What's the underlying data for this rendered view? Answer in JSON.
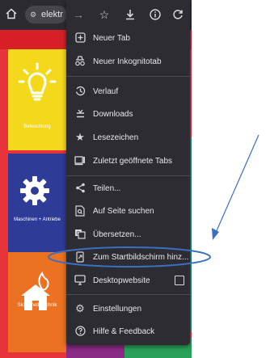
{
  "browser": {
    "url_text": "elektr",
    "toolbar_icons": [
      "home-icon",
      "site-settings-icon",
      "forward-icon",
      "bookmark-star-icon",
      "download-icon",
      "info-icon",
      "reload-icon"
    ]
  },
  "page": {
    "tiles": [
      {
        "label": "Beleuchtung",
        "color": "#f3d81b",
        "icon": "lightbulb-icon"
      },
      {
        "label": "Maschinen + Antriebe",
        "color": "#2f3c97",
        "icon": "gear-icon"
      },
      {
        "label": "Sicherheitstechnik",
        "color": "#ec7121",
        "icon": "house-flame-icon"
      }
    ]
  },
  "menu": {
    "items": [
      {
        "label": "Neuer Tab",
        "icon": "new-tab-icon"
      },
      {
        "label": "Neuer Inkognitotab",
        "icon": "incognito-icon"
      },
      {
        "label": "Verlauf",
        "icon": "history-icon"
      },
      {
        "label": "Downloads",
        "icon": "downloads-icon"
      },
      {
        "label": "Lesezeichen",
        "icon": "bookmarks-star-icon"
      },
      {
        "label": "Zuletzt geöffnete Tabs",
        "icon": "recent-tabs-icon"
      },
      {
        "label": "Teilen...",
        "icon": "share-icon"
      },
      {
        "label": "Auf Seite suchen",
        "icon": "find-in-page-icon"
      },
      {
        "label": "Übersetzen...",
        "icon": "translate-icon"
      },
      {
        "label": "Zum Startbildschirm hinz...",
        "icon": "add-to-home-icon"
      },
      {
        "label": "Desktopwebsite",
        "icon": "desktop-icon"
      },
      {
        "label": "Einstellungen",
        "icon": "settings-gear-icon"
      },
      {
        "label": "Hilfe & Feedback",
        "icon": "help-icon"
      }
    ]
  },
  "annotation": {
    "highlight_color": "#3b6fc1"
  }
}
